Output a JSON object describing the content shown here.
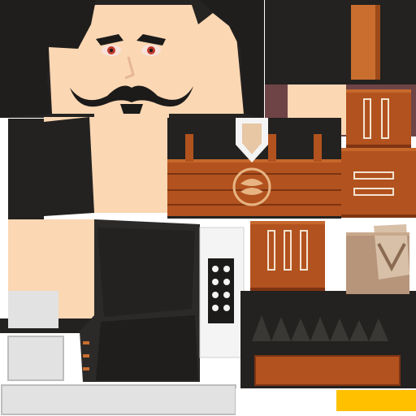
{
  "texture": {
    "kind": "character skin texture atlas",
    "palette": {
      "background": "#ffffff",
      "skin": "#fbd7b4",
      "skin_shade": "#f2c9a4",
      "hair": "#262422",
      "hair_dark": "#1c1b1a",
      "cloth_black": "#232220",
      "cloth_grey": "#2b2a28",
      "leather": "#b2521e",
      "leather_light": "#c6682c",
      "leather_dark": "#7d3412",
      "strap": "#c96e2f",
      "stitch": "#f3e4d2",
      "maroon": "#6e4446",
      "tan": "#b7957a",
      "tan_light": "#d8c0a8",
      "panel_white": "#f4f4f4",
      "panel_grey": "#e2e2e2",
      "eye_white": "#f7e1d8",
      "eye_red": "#c0392b",
      "accent_yellow": "#ffc000"
    },
    "icons": [
      "emblem-icon",
      "shield-icon",
      "mustache-icon",
      "button-grid-icon"
    ]
  }
}
